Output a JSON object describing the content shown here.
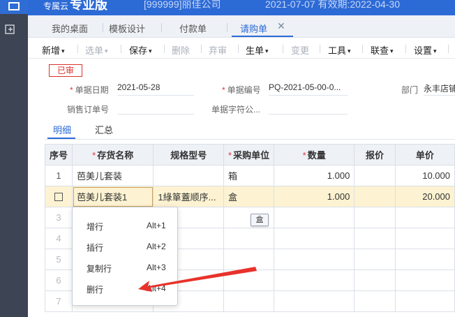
{
  "topbar": {
    "brand_prefix": "专属云",
    "brand_name": "专业版",
    "company": "[999999]丽佳公司",
    "dates": "2021-07-07 有效期:2022-04-30"
  },
  "tabs": [
    {
      "label": "我的桌面"
    },
    {
      "label": "模板设计"
    },
    {
      "label": "付款单"
    },
    {
      "label": "请购单"
    }
  ],
  "toolbar": {
    "items": [
      {
        "label": "新增",
        "caret": "▾"
      },
      {
        "label": "选单",
        "caret": "▾"
      },
      {
        "label": "保存",
        "caret": "▾"
      },
      {
        "label": "删除"
      },
      {
        "label": "弃审"
      },
      {
        "label": "生单",
        "caret": "▾"
      },
      {
        "label": "变更"
      },
      {
        "label": "工具",
        "caret": "▾"
      },
      {
        "label": "联查",
        "caret": "▾"
      },
      {
        "label": "设置",
        "caret": "▾"
      }
    ]
  },
  "status_stamp": "已审",
  "form": {
    "doc_date_label": "单据日期",
    "doc_date": "2021-05-28",
    "doc_no_label": "单据编号",
    "doc_no": "PQ-2021-05-00-0...",
    "dept_label": "部门",
    "dept": "永丰店铺",
    "sales_order_label": "销售订单号",
    "sales_order": "",
    "doc_char_label": "单据字符公...",
    "doc_char": ""
  },
  "subtabs": [
    "明细",
    "汇总"
  ],
  "grid": {
    "headers": [
      "序号",
      "存货名称",
      "规格型号",
      "采购单位",
      "数量",
      "报价",
      "单价"
    ],
    "rows": [
      {
        "idx": "1",
        "name": "芭美儿套装",
        "spec": "",
        "unit": "箱",
        "qty": "1.000",
        "quote": "",
        "price": "10.000"
      },
      {
        "idx": "",
        "name": "芭美儿套装1",
        "spec": "1綠箪蓋顺序...",
        "unit": "盒",
        "qty": "1.000",
        "quote": "",
        "price": "20.000"
      },
      {
        "idx": "3"
      },
      {
        "idx": "4"
      },
      {
        "idx": "5"
      },
      {
        "idx": "6"
      },
      {
        "idx": "7"
      }
    ]
  },
  "tooltip": "盒",
  "context_menu": [
    {
      "label": "增行",
      "shortcut": "Alt+1"
    },
    {
      "label": "插行",
      "shortcut": "Alt+2"
    },
    {
      "label": "复制行",
      "shortcut": "Alt+3"
    },
    {
      "label": "删行",
      "shortcut": "Alt+4"
    }
  ],
  "colors": {
    "accent": "#2c6ad6",
    "stamp": "#d9322b",
    "arrow": "#e8322b",
    "selected_row": "#fdf3d2"
  }
}
